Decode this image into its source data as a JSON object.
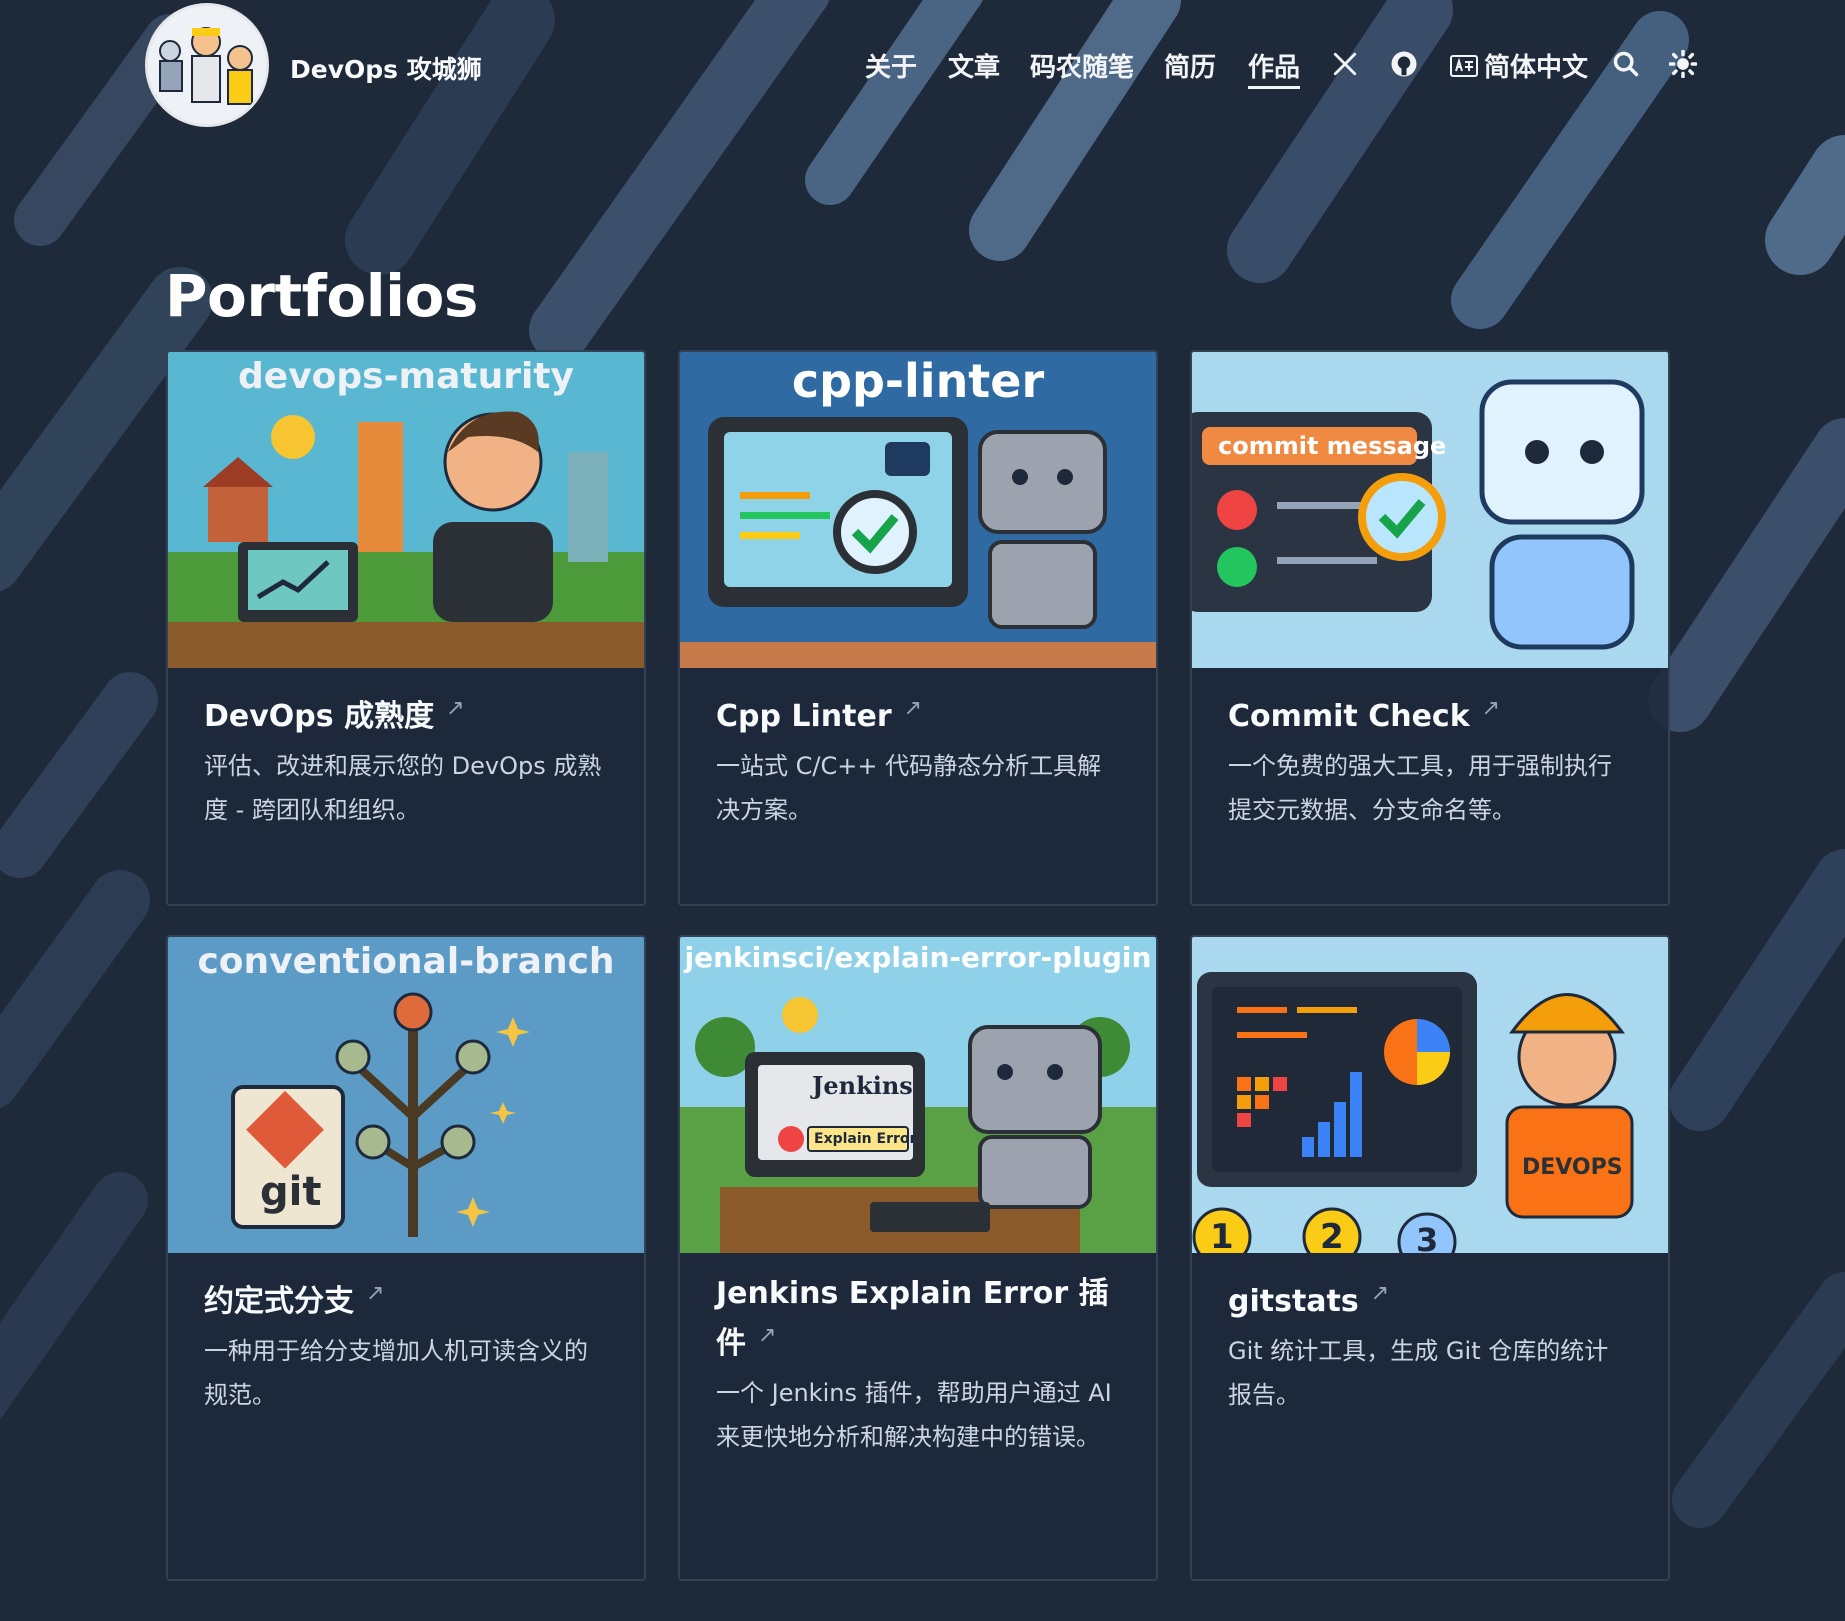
{
  "site": {
    "title": "DevOps 攻城狮"
  },
  "nav": {
    "items": [
      {
        "label": "关于"
      },
      {
        "label": "文章"
      },
      {
        "label": "码农随笔"
      },
      {
        "label": "简历"
      },
      {
        "label": "作品"
      }
    ],
    "active": "作品",
    "language": "简体中文",
    "icons": [
      "x-icon",
      "github-icon",
      "language-icon",
      "search-icon",
      "theme-toggle-icon"
    ]
  },
  "page": {
    "title": "Portfolios"
  },
  "cards": [
    {
      "image_text": "devops-maturity",
      "title": "DevOps 成熟度",
      "description": "评估、改进和展示您的 DevOps 成熟度 - 跨团队和组织。"
    },
    {
      "image_text": "cpp-linter",
      "title": "Cpp Linter",
      "description": "一站式 C/C++ 代码静态分析工具解决方案。"
    },
    {
      "image_text": "commit message",
      "title": "Commit Check",
      "description": "一个免费的强大工具，用于强制执行提交元数据、分支命名等。"
    },
    {
      "image_text": "conventional-branch",
      "title": "约定式分支",
      "description": "一种用于给分支增加人机可读含义的规范。"
    },
    {
      "image_text": "jenkinsci/explain-error-plugin",
      "image_sub1": "Jenkins",
      "image_sub2": "Explain Error",
      "title": "Jenkins Explain Error 插件",
      "description": "一个 Jenkins 插件，帮助用户通过 AI 来更快地分析和解决构建中的错误。"
    },
    {
      "image_text": "DEVOPS",
      "image_sub1": "1",
      "image_sub2": "2",
      "image_sub3": "3",
      "title": "gitstats",
      "description": "Git 统计工具，生成 Git 仓库的统计报告。"
    }
  ],
  "colors": {
    "background": "#1e2939",
    "card": "#1e293b",
    "accent": "#f97316"
  }
}
